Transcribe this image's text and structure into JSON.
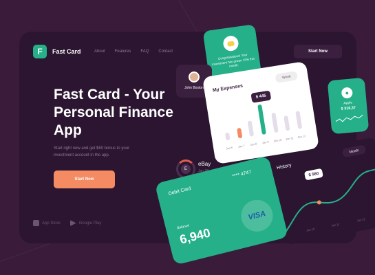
{
  "app": {
    "name": "Fast Card",
    "logo_letter": "F"
  },
  "nav": {
    "items": [
      "About",
      "Features",
      "FAQ",
      "Contact"
    ]
  },
  "header": {
    "start_label": "Start Now"
  },
  "hero": {
    "title": "Fast Card - Your Personal Finance App",
    "subtitle": "Start right now and get $50 bonus to your investment account in the app.",
    "button_label": "Start Now"
  },
  "stores": {
    "app_store": "App Store",
    "google_play": "Google Play"
  },
  "congrats": {
    "text": "Congratulations! Your investment has grown 15% this month."
  },
  "profile": {
    "name": "John Boston"
  },
  "expenses": {
    "title": "My Expenses",
    "period": "Week",
    "tooltip": "$ 445"
  },
  "apple": {
    "name": "Apple",
    "price": "$ 318,37",
    "icon": "apple-icon"
  },
  "ebay": {
    "name": "eBay",
    "letter": "E",
    "date": "Jan 28"
  },
  "history": {
    "title": "History",
    "period": "Month",
    "tooltip": "$ 560",
    "labels": [
      "Jan 10",
      "Jan 11",
      "Jan 12"
    ]
  },
  "debit": {
    "title": "Debit Card",
    "number": "**** 4747",
    "balance_label": "Balance",
    "balance": "6,940",
    "brand": "VISA"
  },
  "chart_data": {
    "type": "bar",
    "categories": [
      "Jan 6",
      "Jan 7",
      "Jan 8",
      "Jan 9",
      "Jan 10",
      "Jan 11",
      "Jan 12"
    ],
    "values": [
      15,
      20,
      32,
      60,
      40,
      30,
      35
    ],
    "highlight": [
      null,
      "#f58b63",
      null,
      "#25b089",
      null,
      null,
      null
    ]
  },
  "colors": {
    "accent": "#25b089",
    "orange": "#f58b63",
    "bg": "#3a1b3a",
    "panel": "#2b1530"
  }
}
